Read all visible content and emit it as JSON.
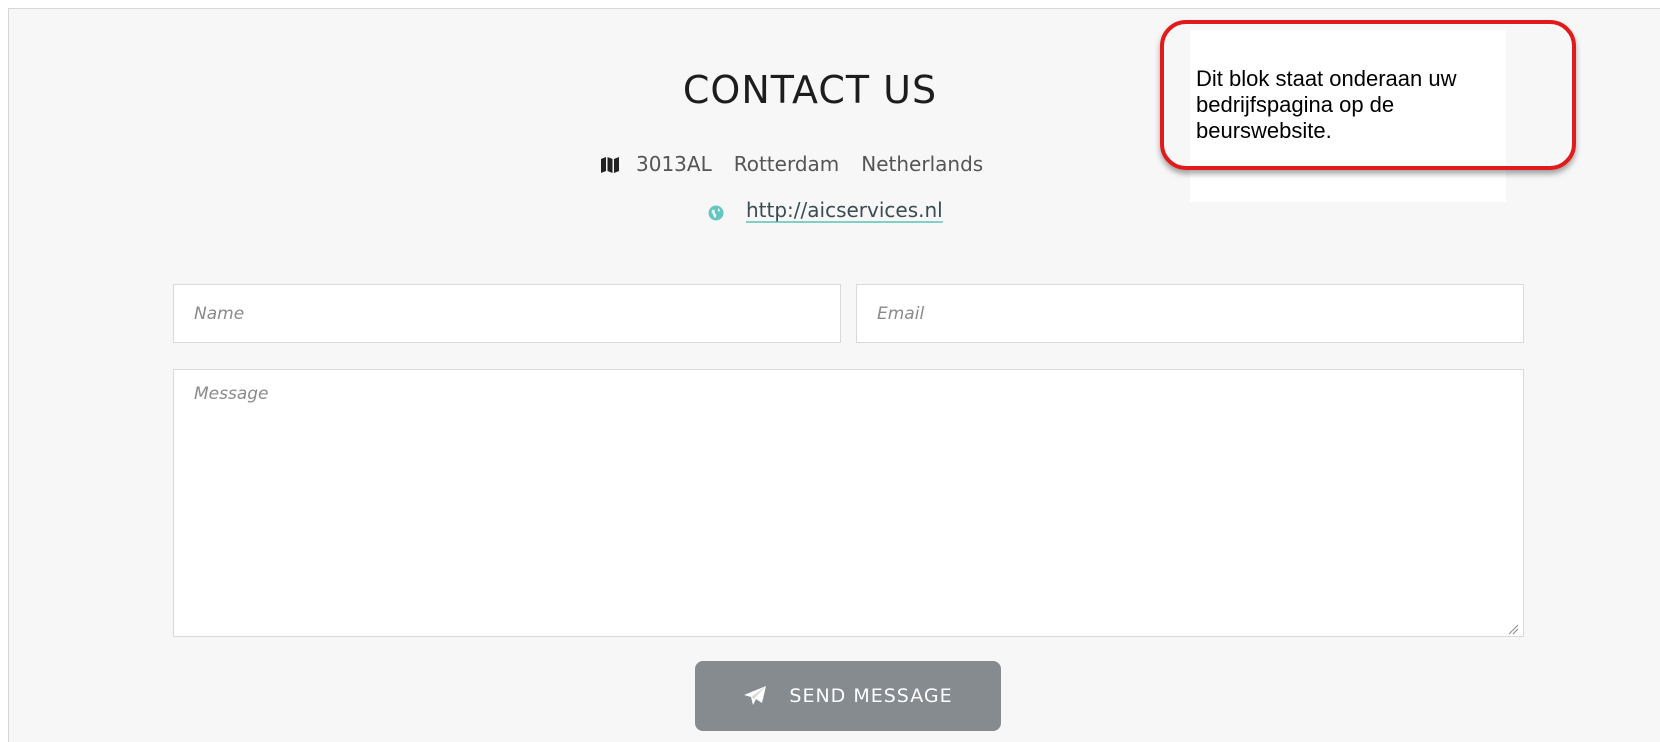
{
  "contact": {
    "title": "CONTACT US",
    "postal_code": "3013AL",
    "city": "Rotterdam",
    "country": "Netherlands",
    "website": "http://aicservices.nl"
  },
  "form": {
    "name_placeholder": "Name",
    "email_placeholder": "Email",
    "message_placeholder": "Message",
    "send_label": "SEND MESSAGE"
  },
  "callout": {
    "text": "Dit blok staat onderaan uw bedrijfspagina op de beurswebsite."
  },
  "icons": {
    "address": "map-icon",
    "website": "globe-icon",
    "send": "paper-plane-icon"
  },
  "colors": {
    "button": "#868b90",
    "callout_border": "#e11b1b",
    "link_underline": "#7fd0c8",
    "globe": "#66c7c0"
  }
}
